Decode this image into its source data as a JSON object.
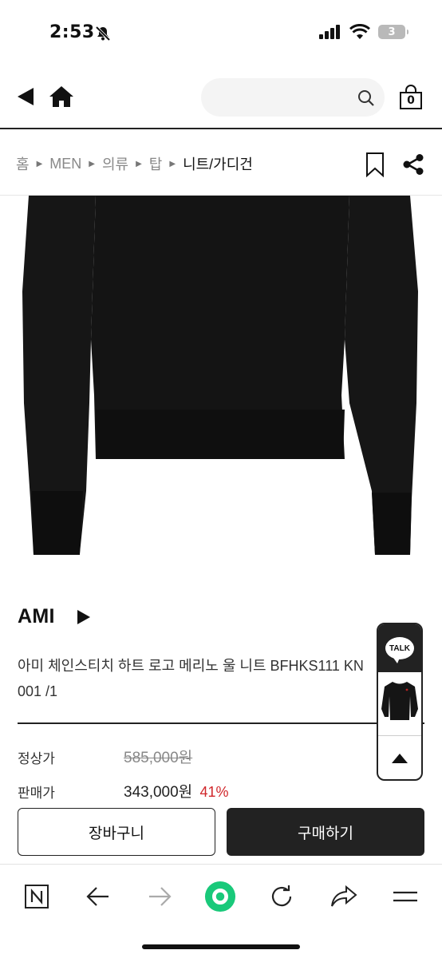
{
  "status_bar": {
    "time": "2:53",
    "battery": "3"
  },
  "header": {
    "cart_count": "0"
  },
  "breadcrumb": [
    {
      "label": "홈"
    },
    {
      "label": "MEN"
    },
    {
      "label": "의류"
    },
    {
      "label": "탑"
    },
    {
      "label": "니트/가디건"
    }
  ],
  "product": {
    "brand": "AMI",
    "name": "아미 체인스티치 하트 로고 메리노 울 니트 BFHKS111 KN0001 /1",
    "name_line1": "아미 체인스티치 하트 로고 메리노 울 니트 BFHKS111 KN",
    "name_line2": "001 /1"
  },
  "pricing": {
    "original_label": "정상가",
    "original_price": "585,000원",
    "sale_label": "판매가",
    "sale_price": "343,000원",
    "discount": "41%"
  },
  "actions": {
    "cart": "장바구니",
    "buy": "구매하기"
  },
  "floating": {
    "talk": "TALK"
  },
  "colors": {
    "accent_green": "#19c97a",
    "discount_red": "#d0262a",
    "dark": "#222222"
  },
  "icons": [
    "back-icon",
    "home-icon",
    "search-icon",
    "shopping-bag-icon",
    "bookmark-icon",
    "share-icon",
    "play-icon",
    "naver-n-icon",
    "arrow-left-icon",
    "arrow-right-icon",
    "green-dot-icon",
    "refresh-icon",
    "forward-share-icon",
    "menu-icon"
  ]
}
